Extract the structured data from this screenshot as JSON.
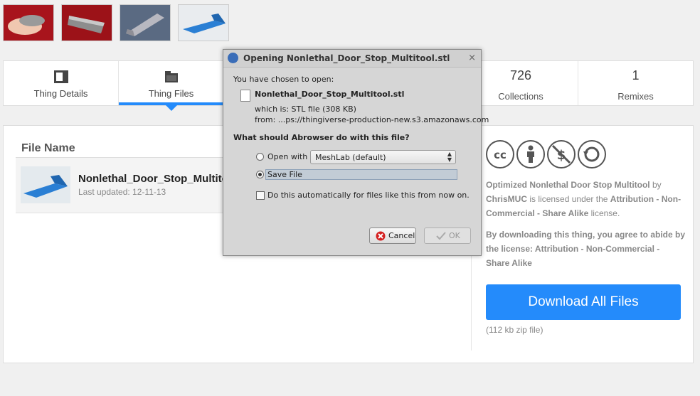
{
  "colors": {
    "accent": "#248bfb",
    "text": "#333333",
    "muted": "#888888"
  },
  "thumbnails": [
    {
      "name": "thumb-hand-red"
    },
    {
      "name": "thumb-chain-red"
    },
    {
      "name": "thumb-chain-grey"
    },
    {
      "name": "thumb-blue-stop"
    }
  ],
  "tabs": {
    "thing_details": "Thing Details",
    "thing_files": "Thing Files",
    "collections_count": "726",
    "collections_label": "Collections",
    "remixes_count": "1",
    "remixes_label": "Remixes"
  },
  "files": {
    "header": "File Name",
    "name": "Nonlethal_Door_Stop_Multito",
    "updated": "Last updated: 12-11-13"
  },
  "license": {
    "icons": [
      "cc-icon",
      "attribution-icon",
      "noncommercial-icon",
      "sharealike-icon"
    ],
    "title": "Optimized Nonlethal Door Stop Multitool",
    "by": "by",
    "author": "ChrisMUC",
    "is_licensed": "is licensed under the",
    "license_name": "Attribution - Non-Commercial - Share Alike",
    "suffix": "license.",
    "agree": "By downloading this thing, you agree to abide by the license: Attribution - Non-Commercial - Share Alike"
  },
  "download": {
    "label": "Download All Files",
    "size": "(112 kb zip file)"
  },
  "dialog": {
    "title": "Opening Nonlethal_Door_Stop_Multitool.stl",
    "chosen": "You have chosen to open:",
    "filename": "Nonlethal_Door_Stop_Multitool.stl",
    "which_is": "which is:  STL file (308 KB)",
    "from": "from:   ...ps://thingiverse-production-new.s3.amazonaws.com",
    "question": "What should Abrowser do with this file?",
    "open_with": "Open with",
    "open_with_app": "MeshLab (default)",
    "save_file": "Save File",
    "auto": "Do this automatically for files like this from now on.",
    "cancel": "Cancel",
    "ok": "OK",
    "close": "×"
  }
}
